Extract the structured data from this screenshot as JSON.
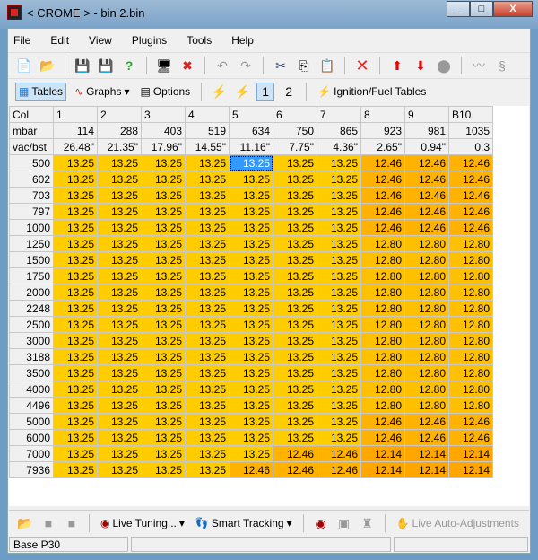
{
  "window": {
    "title": "< CROME > - bin 2.bin",
    "buttons": [
      "minimize",
      "maximize",
      "close"
    ]
  },
  "menu": [
    "File",
    "Edit",
    "View",
    "Plugins",
    "Tools",
    "Help"
  ],
  "toolbar1": [
    "new-icon",
    "open-icon",
    "save-icon",
    "save-as-icon",
    "compare-icon",
    "properties-icon",
    "close-file-icon",
    "undo-icon",
    "redo-icon",
    "cut-icon",
    "copy-icon",
    "paste-icon",
    "delete-icon",
    "increase-icon",
    "decrease-icon",
    "stop-icon",
    "interpolate-icon",
    "smooth-icon"
  ],
  "toolbar2": {
    "tables": "Tables",
    "graphs": "Graphs",
    "options": "Options",
    "ignfuel": "Ignition/Fuel Tables"
  },
  "table": {
    "corner": "Col",
    "columns": [
      "1",
      "2",
      "3",
      "4",
      "5",
      "6",
      "7",
      "8",
      "9",
      "B10"
    ],
    "mbar_label": "mbar",
    "mbar": [
      "114",
      "288",
      "403",
      "519",
      "634",
      "750",
      "865",
      "923",
      "981",
      "1035"
    ],
    "vac_label": "vac/bst",
    "vac": [
      "26.48\"",
      "21.35\"",
      "17.96\"",
      "14.55\"",
      "11.16\"",
      "7.75\"",
      "4.36\"",
      "2.65\"",
      "0.94\"",
      "0.3"
    ],
    "selected": {
      "row": 0,
      "col": 4
    },
    "colors": {
      "13.25": "#ffcc00",
      "12.80": "#ffc000",
      "12.46": "#ffb300",
      "12.14": "#ffa600"
    },
    "rows": [
      {
        "rpm": "500",
        "values": [
          "13.25",
          "13.25",
          "13.25",
          "13.25",
          "13.25",
          "13.25",
          "13.25",
          "12.46",
          "12.46",
          "12.46"
        ]
      },
      {
        "rpm": "602",
        "values": [
          "13.25",
          "13.25",
          "13.25",
          "13.25",
          "13.25",
          "13.25",
          "13.25",
          "12.46",
          "12.46",
          "12.46"
        ]
      },
      {
        "rpm": "703",
        "values": [
          "13.25",
          "13.25",
          "13.25",
          "13.25",
          "13.25",
          "13.25",
          "13.25",
          "12.46",
          "12.46",
          "12.46"
        ]
      },
      {
        "rpm": "797",
        "values": [
          "13.25",
          "13.25",
          "13.25",
          "13.25",
          "13.25",
          "13.25",
          "13.25",
          "12.46",
          "12.46",
          "12.46"
        ]
      },
      {
        "rpm": "1000",
        "values": [
          "13.25",
          "13.25",
          "13.25",
          "13.25",
          "13.25",
          "13.25",
          "13.25",
          "12.46",
          "12.46",
          "12.46"
        ]
      },
      {
        "rpm": "1250",
        "values": [
          "13.25",
          "13.25",
          "13.25",
          "13.25",
          "13.25",
          "13.25",
          "13.25",
          "12.80",
          "12.80",
          "12.80"
        ]
      },
      {
        "rpm": "1500",
        "values": [
          "13.25",
          "13.25",
          "13.25",
          "13.25",
          "13.25",
          "13.25",
          "13.25",
          "12.80",
          "12.80",
          "12.80"
        ]
      },
      {
        "rpm": "1750",
        "values": [
          "13.25",
          "13.25",
          "13.25",
          "13.25",
          "13.25",
          "13.25",
          "13.25",
          "12.80",
          "12.80",
          "12.80"
        ]
      },
      {
        "rpm": "2000",
        "values": [
          "13.25",
          "13.25",
          "13.25",
          "13.25",
          "13.25",
          "13.25",
          "13.25",
          "12.80",
          "12.80",
          "12.80"
        ]
      },
      {
        "rpm": "2248",
        "values": [
          "13.25",
          "13.25",
          "13.25",
          "13.25",
          "13.25",
          "13.25",
          "13.25",
          "12.80",
          "12.80",
          "12.80"
        ]
      },
      {
        "rpm": "2500",
        "values": [
          "13.25",
          "13.25",
          "13.25",
          "13.25",
          "13.25",
          "13.25",
          "13.25",
          "12.80",
          "12.80",
          "12.80"
        ]
      },
      {
        "rpm": "3000",
        "values": [
          "13.25",
          "13.25",
          "13.25",
          "13.25",
          "13.25",
          "13.25",
          "13.25",
          "12.80",
          "12.80",
          "12.80"
        ]
      },
      {
        "rpm": "3188",
        "values": [
          "13.25",
          "13.25",
          "13.25",
          "13.25",
          "13.25",
          "13.25",
          "13.25",
          "12.80",
          "12.80",
          "12.80"
        ]
      },
      {
        "rpm": "3500",
        "values": [
          "13.25",
          "13.25",
          "13.25",
          "13.25",
          "13.25",
          "13.25",
          "13.25",
          "12.80",
          "12.80",
          "12.80"
        ]
      },
      {
        "rpm": "4000",
        "values": [
          "13.25",
          "13.25",
          "13.25",
          "13.25",
          "13.25",
          "13.25",
          "13.25",
          "12.80",
          "12.80",
          "12.80"
        ]
      },
      {
        "rpm": "4496",
        "values": [
          "13.25",
          "13.25",
          "13.25",
          "13.25",
          "13.25",
          "13.25",
          "13.25",
          "12.80",
          "12.80",
          "12.80"
        ]
      },
      {
        "rpm": "5000",
        "values": [
          "13.25",
          "13.25",
          "13.25",
          "13.25",
          "13.25",
          "13.25",
          "13.25",
          "12.46",
          "12.46",
          "12.46"
        ]
      },
      {
        "rpm": "6000",
        "values": [
          "13.25",
          "13.25",
          "13.25",
          "13.25",
          "13.25",
          "13.25",
          "13.25",
          "12.46",
          "12.46",
          "12.46"
        ]
      },
      {
        "rpm": "7000",
        "values": [
          "13.25",
          "13.25",
          "13.25",
          "13.25",
          "13.25",
          "12.46",
          "12.46",
          "12.14",
          "12.14",
          "12.14"
        ]
      },
      {
        "rpm": "7936",
        "values": [
          "13.25",
          "13.25",
          "13.25",
          "13.25",
          "12.46",
          "12.46",
          "12.46",
          "12.14",
          "12.14",
          "12.14"
        ]
      }
    ]
  },
  "bottom": {
    "live_tuning": "Live Tuning...",
    "smart_tracking": "Smart Tracking",
    "live_auto": "Live Auto-Adjustments"
  },
  "status": {
    "left": "Base P30",
    "middle": "",
    "right": ""
  }
}
